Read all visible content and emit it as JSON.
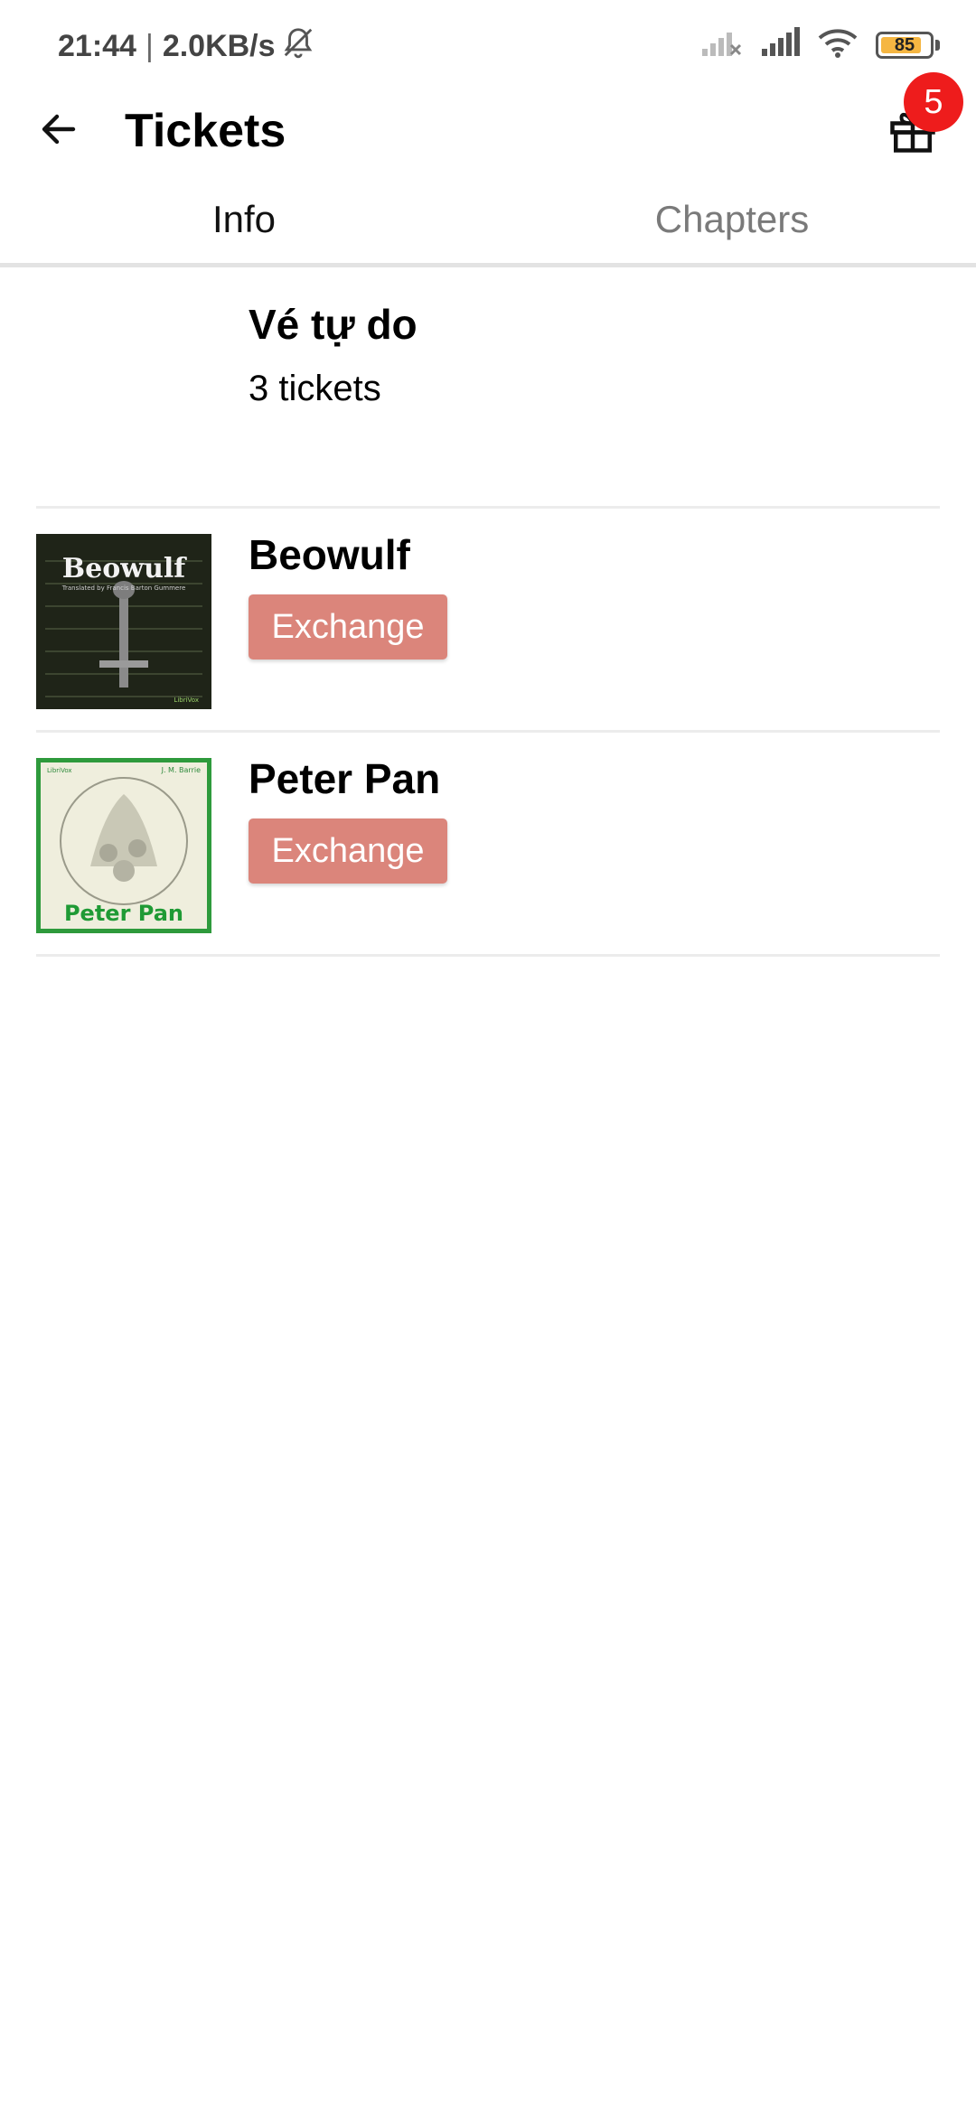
{
  "status_bar": {
    "time": "21:44",
    "separator": "|",
    "speed": "2.0KB/s",
    "mute_icon": "bell-off-icon",
    "battery_level": "85",
    "battery_fraction": 0.85
  },
  "app_bar": {
    "title": "Tickets",
    "back_icon": "arrow-left-icon",
    "gift_icon": "gift-icon",
    "gift_badge": "5"
  },
  "tabs": [
    {
      "label": "Info",
      "active": true
    },
    {
      "label": "Chapters",
      "active": false
    }
  ],
  "free_ticket": {
    "title": "Vé tự do",
    "count": "3 tickets"
  },
  "books": [
    {
      "title": "Beowulf",
      "action": "Exchange",
      "cover": {
        "title": "Beowulf",
        "subtitle": "Translated by Francis Barton Gummere",
        "publisher": "LibriVox"
      }
    },
    {
      "title": "Peter Pan",
      "action": "Exchange",
      "cover": {
        "title": "Peter Pan",
        "author": "J. M. Barrie",
        "publisher": "LibriVox"
      }
    }
  ],
  "colors": {
    "exchange_button": "#db857b",
    "badge": "#ee1c1c",
    "battery_fill": "#f5b642"
  }
}
